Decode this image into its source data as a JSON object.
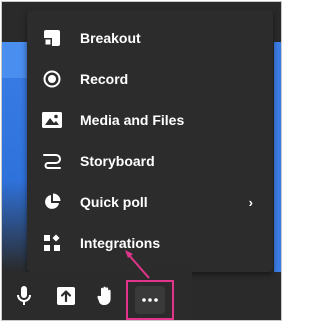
{
  "menu": {
    "items": [
      {
        "label": "Breakout",
        "icon": "breakout-room-icon"
      },
      {
        "label": "Record",
        "icon": "record-icon"
      },
      {
        "label": "Media and Files",
        "icon": "image-icon"
      },
      {
        "label": "Storyboard",
        "icon": "storyboard-icon"
      },
      {
        "label": "Quick poll",
        "icon": "pie-chart-icon",
        "has_submenu": true
      },
      {
        "label": "Integrations",
        "icon": "apps-grid-icon"
      }
    ],
    "submenu_chevron": "›"
  },
  "toolbar": {
    "buttons": [
      {
        "icon": "microphone-icon"
      },
      {
        "icon": "share-screen-icon"
      },
      {
        "icon": "raise-hand-icon"
      },
      {
        "icon": "more-options-icon"
      }
    ]
  },
  "colors": {
    "menu_bg": "#2c2c2c",
    "highlight": "#e0358a",
    "stage_blue": "#3b7de6"
  }
}
